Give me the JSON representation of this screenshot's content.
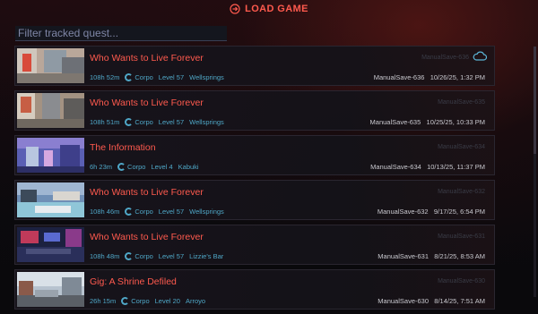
{
  "header": {
    "title": "LOAD GAME",
    "icon": "exit-icon"
  },
  "filter": {
    "placeholder": "Filter tracked quest..."
  },
  "saves": [
    {
      "title": "Who Wants to Live Forever",
      "playtime": "108h 52m",
      "lifepath": "Corpo",
      "level": "Level 57",
      "location": "Wellsprings",
      "save_name": "ManualSave-636",
      "datetime": "10/26/25, 1:32 PM",
      "faint": "ManualSave-636",
      "cloud": true
    },
    {
      "title": "Who Wants to Live Forever",
      "playtime": "108h 51m",
      "lifepath": "Corpo",
      "level": "Level 57",
      "location": "Wellsprings",
      "save_name": "ManualSave-635",
      "datetime": "10/25/25, 10:33 PM",
      "faint": "ManualSave-635",
      "cloud": false
    },
    {
      "title": "The Information",
      "playtime": "6h 23m",
      "lifepath": "Corpo",
      "level": "Level 4",
      "location": "Kabuki",
      "save_name": "ManualSave-634",
      "datetime": "10/13/25, 11:37 PM",
      "faint": "ManualSave-634",
      "cloud": false
    },
    {
      "title": "Who Wants to Live Forever",
      "playtime": "108h 46m",
      "lifepath": "Corpo",
      "level": "Level 57",
      "location": "Wellsprings",
      "save_name": "ManualSave-632",
      "datetime": "9/17/25, 6:54 PM",
      "faint": "ManualSave-632",
      "cloud": false
    },
    {
      "title": "Who Wants to Live Forever",
      "playtime": "108h 48m",
      "lifepath": "Corpo",
      "level": "Level 57",
      "location": "Lizzie's Bar",
      "save_name": "ManualSave-631",
      "datetime": "8/21/25, 8:53 AM",
      "faint": "ManualSave-631",
      "cloud": false
    },
    {
      "title": "Gig: A Shrine Defiled",
      "playtime": "26h 15m",
      "lifepath": "Corpo",
      "level": "Level 20",
      "location": "Arroyo",
      "save_name": "ManualSave-630",
      "datetime": "8/14/25, 7:51 AM",
      "faint": "ManualSave-630",
      "cloud": false
    }
  ],
  "colors": {
    "accent": "#ff5a4e",
    "info": "#4fa7c7"
  }
}
